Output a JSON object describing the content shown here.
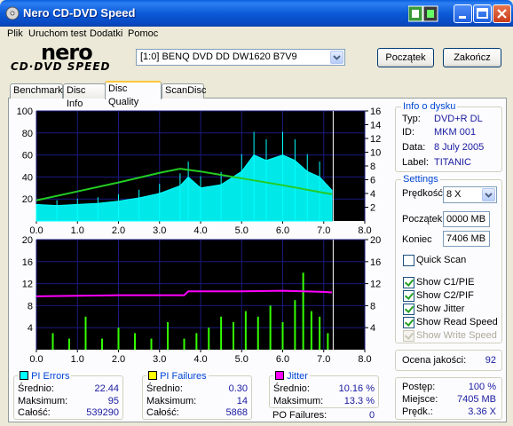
{
  "window": {
    "title": "Nero CD-DVD Speed"
  },
  "menu": [
    "Plik",
    "Uruchom test",
    "Dodatki",
    "Pomoc"
  ],
  "logo": {
    "top": "nero",
    "bottom": "CD·DVD SPEED"
  },
  "drive": {
    "selected": "[1:0]   BENQ DVD DD DW1620 B7V9"
  },
  "buttons": {
    "start": "Początek",
    "end": "Zakończ"
  },
  "tabs": [
    "Benchmark",
    "Disc Info",
    "Disc Quality",
    "ScanDisc"
  ],
  "active_tab": "Disc Quality",
  "info": {
    "title": "Info o dysku",
    "type_label": "Typ:",
    "type": "DVD+R DL",
    "id_label": "ID:",
    "id": "MKM 001",
    "date_label": "Data:",
    "date": "8 July 2005",
    "label_label": "Label:",
    "label": "TITANIC"
  },
  "settings": {
    "title": "Settings",
    "speed_label": "Prędkość",
    "speed": "8 X",
    "start_label": "Początek",
    "start": "0000 MB",
    "end_label": "Koniec",
    "end": "7406 MB",
    "quick_scan": "Quick Scan",
    "show_c1": "Show C1/PIE",
    "show_c2": "Show C2/PIF",
    "show_jitter": "Show Jitter",
    "show_read": "Show Read Speed",
    "show_write": "Show Write Speed"
  },
  "quality": {
    "label": "Ocena jakości:",
    "value": "92"
  },
  "progress": {
    "progress_label": "Postęp:",
    "progress_value": "100 %",
    "place_label": "Miejsce:",
    "place_value": "7405 MB",
    "speed_label": "Prędk.:",
    "speed_value": "3.36 X"
  },
  "pi_errors": {
    "title": "PI Errors",
    "avg_label": "Średnio:",
    "avg": "22.44",
    "max_label": "Maksimum:",
    "max": "95",
    "total_label": "Całość:",
    "total": "539290",
    "color": "#00ffff"
  },
  "pi_failures": {
    "title": "PI Failures",
    "avg_label": "Średnio:",
    "avg": "0.30",
    "max_label": "Maksimum:",
    "max": "14",
    "total_label": "Całość:",
    "total": "5868",
    "color": "#ffff00"
  },
  "jitter": {
    "title": "Jitter",
    "avg_label": "Średnio:",
    "avg": "10.16 %",
    "max_label": "Maksimum:",
    "max": "13.3 %",
    "po_label": "PO Failures:",
    "po": "0",
    "color": "#ff00ff"
  },
  "chart_data": [
    {
      "type": "area",
      "name": "PI Errors",
      "x_ticks": [
        "0.0",
        "1.0",
        "2.0",
        "3.0",
        "4.0",
        "5.0",
        "6.0",
        "7.0",
        "8.0"
      ],
      "y_ticks_left": [
        "20",
        "40",
        "60",
        "80",
        "100"
      ],
      "y_ticks_right": [
        "2",
        "4",
        "6",
        "8",
        "10",
        "12",
        "14",
        "16"
      ],
      "xlim": [
        0,
        8
      ],
      "ylim_left": [
        0,
        100
      ],
      "ylim_right": [
        0,
        16
      ],
      "pi_errors": {
        "x": [
          0,
          0.5,
          1,
          1.5,
          2,
          2.5,
          3,
          3.5,
          3.7,
          4,
          4.5,
          5,
          5.3,
          5.6,
          6,
          6.3,
          6.6,
          6.9,
          7.2
        ],
        "y": [
          15,
          14,
          15,
          16,
          18,
          21,
          25,
          32,
          40,
          30,
          33,
          45,
          60,
          55,
          60,
          55,
          45,
          40,
          28
        ]
      },
      "read_speed": {
        "x": [
          0,
          1,
          2,
          3,
          3.5,
          4,
          5,
          6,
          7,
          7.2
        ],
        "y": [
          3.0,
          4.3,
          5.6,
          7.0,
          7.6,
          7.2,
          6.2,
          5.2,
          4.1,
          3.9
        ]
      },
      "end_marker": 7.23
    },
    {
      "type": "bar",
      "name": "PI Failures / Jitter",
      "x_ticks": [
        "0.0",
        "1.0",
        "2.0",
        "3.0",
        "4.0",
        "5.0",
        "6.0",
        "7.0",
        "8.0"
      ],
      "y_ticks_left": [
        "4",
        "8",
        "12",
        "16",
        "20"
      ],
      "y_ticks_right": [
        "4",
        "8",
        "12",
        "16",
        "20"
      ],
      "xlim": [
        0,
        8
      ],
      "ylim": [
        0,
        20
      ],
      "pi_failures": {
        "x": [
          0.4,
          0.8,
          1.2,
          1.6,
          2.0,
          2.4,
          2.8,
          3.2,
          3.6,
          3.9,
          4.2,
          4.5,
          4.8,
          5.1,
          5.4,
          5.7,
          6.0,
          6.3,
          6.5,
          6.7,
          6.9,
          7.1
        ],
        "y": [
          3,
          2,
          6,
          2,
          4,
          3,
          2,
          5,
          2,
          3,
          4,
          6,
          5,
          7,
          6,
          8,
          5,
          9,
          14,
          7,
          6,
          3
        ]
      },
      "jitter": {
        "x": [
          0,
          1,
          2,
          3,
          3.6,
          3.7,
          4,
          5,
          6,
          7,
          7.2
        ],
        "y": [
          9.7,
          9.8,
          9.9,
          9.9,
          9.9,
          10.6,
          10.6,
          10.6,
          10.7,
          10.5,
          10.4
        ]
      },
      "end_marker": 7.23
    }
  ]
}
